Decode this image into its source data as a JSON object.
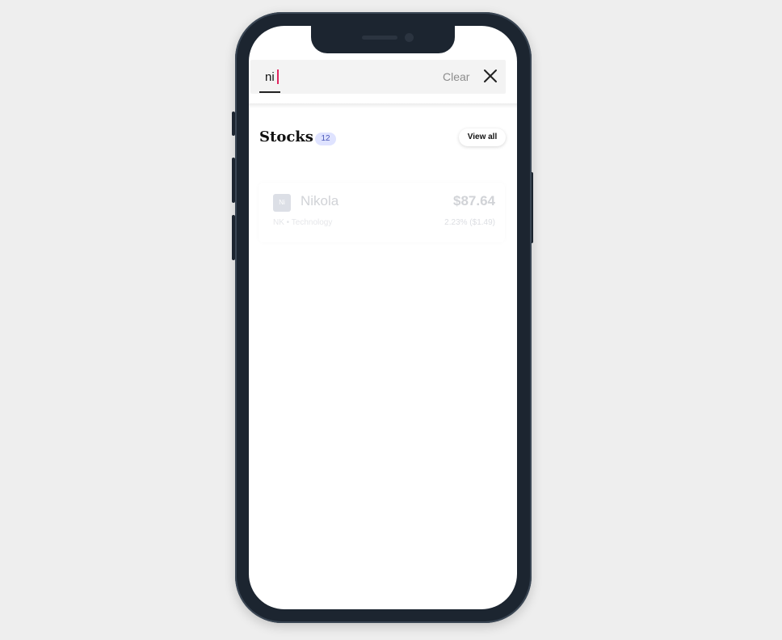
{
  "search": {
    "value": "ni",
    "clear_label": "Clear"
  },
  "stocks_section": {
    "title": "Stocks",
    "count": "12",
    "view_all_label": "View all"
  },
  "stock_result": {
    "logo_text": "Ni",
    "name": "Nikola",
    "price": "$87.64",
    "subtitle": "NK • Technology",
    "change": "2.23% ($1.49)"
  },
  "colors": {
    "accent_caret": "#e0245e",
    "badge_bg": "#dfe3ff",
    "phone_frame": "#1c2530"
  },
  "icons": {
    "close": "close-icon"
  }
}
